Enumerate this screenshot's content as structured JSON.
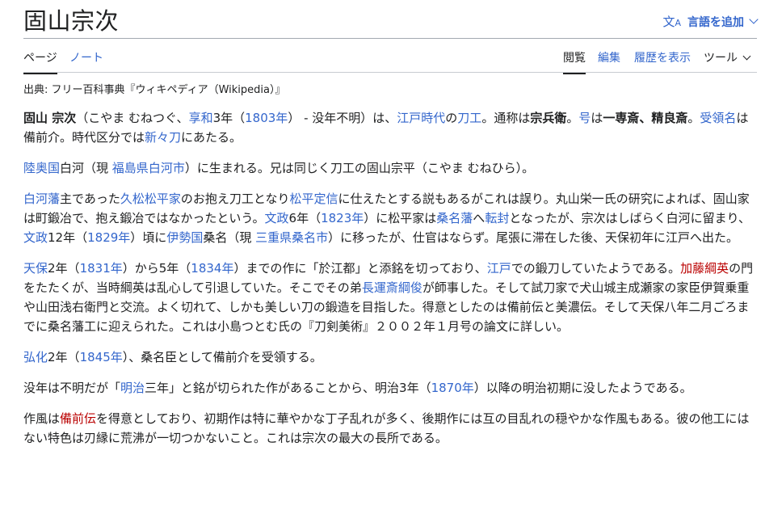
{
  "page": {
    "title": "固山宗次"
  },
  "language_button": {
    "icon": "translate-icon",
    "label": "言語を追加"
  },
  "tabs_left": [
    {
      "label": "ページ"
    },
    {
      "label": "ノート"
    }
  ],
  "tabs_right": [
    {
      "label": "閲覧"
    },
    {
      "label": "編集"
    },
    {
      "label": "履歴を表示"
    },
    {
      "label": "ツール"
    }
  ],
  "source": "出典: フリー百科事典『ウィキペディア（Wikipedia）』",
  "p1": {
    "bold_name": "固山 宗次",
    "t1": "（こやま むねつぐ、",
    "l1": "享和",
    "t2": "3年（",
    "l2": "1803年",
    "t3": "） - 没年不明）は、",
    "l3": "江戸時代",
    "t4": "の",
    "l4": "刀工",
    "t5": "。通称は",
    "b1": "宗兵衛",
    "t6": "。",
    "l5": "号",
    "t7": "は",
    "b2": "一専斎、精良斎",
    "t8": "。",
    "l6": "受領名",
    "t9": "は備前介。時代区分では",
    "l7": "新々刀",
    "t10": "にあたる。"
  },
  "p2": {
    "l1": "陸奥国",
    "t1": "白河（現 ",
    "l2": "福島県",
    "l3": "白河市",
    "t2": "）に生まれる。兄は同じく刀工の固山宗平（こやま むねひら）。"
  },
  "p3": {
    "l1": "白河藩",
    "t1": "主であった",
    "l2": "久松松平家",
    "t2": "のお抱え刀工となり",
    "l3": "松平定信",
    "t3": "に仕えたとする説もあるがこれは誤り。丸山栄一氏の研究によれば、固山家は町鍛冶で、抱え鍛冶ではなかったという。",
    "l4": "文政",
    "t4": "6年（",
    "l5": "1823年",
    "t5": "）に松平家は",
    "l6": "桑名藩",
    "t6": "へ",
    "l7": "転封",
    "t7": "となったが、宗次はしばらく白河に留まり、",
    "l8": "文政",
    "t8": "12年（",
    "l9": "1829年",
    "t9": "）頃に",
    "l10": "伊勢国",
    "t10": "桑名（現 ",
    "l11": "三重県",
    "l12": "桑名市",
    "t11": "）に移ったが、仕官はならず。尾張に滞在した後、天保初年に江戸へ出た。"
  },
  "p4": {
    "l1": "天保",
    "t1": "2年（",
    "l2": "1831年",
    "t2": "）から5年（",
    "l3": "1834年",
    "t3": "）までの作に「於江都」と添銘を切っており、",
    "l4": "江戸",
    "t4": "での鍛刀していたようである。",
    "r1": "加藤綱英",
    "t5": "の門をたたくが、当時綱英は乱心して引退していた。そこでその弟",
    "l5": "長運斎綱俊",
    "t6": "が師事した。そして試刀家で犬山城主成瀬家の家臣伊賀乗重や山田浅右衛門と交流。よく切れて、しかも美しい刀の鍛造を目指した。得意としたのは備前伝と美濃伝。そして天保八年二月ごろまでに桑名藩工に迎えられた。これは小島つとむ氏の『刀剣美術』２００２年１月号の論文に詳しい。"
  },
  "p5": {
    "l1": "弘化",
    "t1": "2年（",
    "l2": "1845年",
    "t2": "）、桑名臣として備前介を受領する。"
  },
  "p6": {
    "t1": "没年は不明だが「",
    "l1": "明治",
    "t2": "三年」と銘が切られた作があることから、明治3年（",
    "l2": "1870年",
    "t3": "）以降の明治初期に没したようである。"
  },
  "p7": {
    "t1": "作風は",
    "r1": "備前伝",
    "t2": "を得意としており、初期作は特に華やかな丁子乱れが多く、後期作には互の目乱れの穏やかな作風もある。彼の他工にはない特色は刃縁に荒沸が一切つかないこと。これは宗次の最大の長所である。"
  },
  "colors": {
    "link": "#3366cc",
    "redlink": "#ba0000",
    "text": "#202122"
  }
}
